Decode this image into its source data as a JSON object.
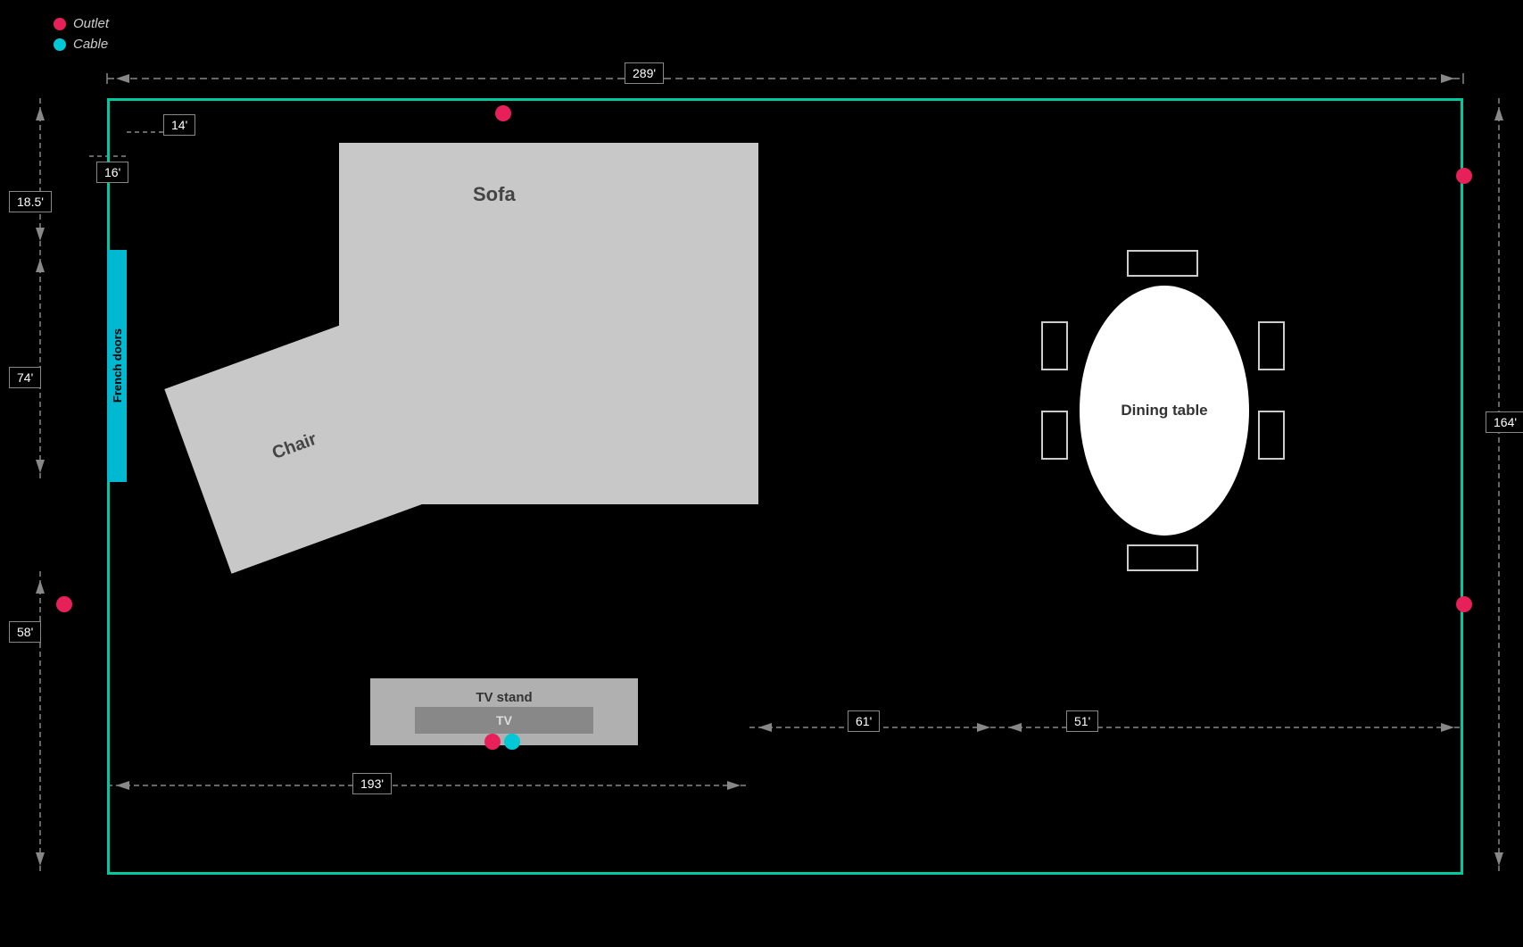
{
  "legend": {
    "outlet_label": "Outlet",
    "cable_label": "Cable"
  },
  "dimensions": {
    "top_width": "289'",
    "door_segment1": "14'",
    "door_segment2": "16'",
    "left_top": "18.5'",
    "french_doors_height": "74'",
    "left_bottom": "58'",
    "right_height": "164'",
    "bottom_left": "193'",
    "bottom_mid": "61'",
    "bottom_right": "51'"
  },
  "furniture": {
    "sofa_label": "Sofa",
    "chair_label": "Chair",
    "tvstand_label": "TV stand",
    "tv_label": "TV",
    "dining_label": "Dining\ntable",
    "french_doors_label": "French doors"
  }
}
